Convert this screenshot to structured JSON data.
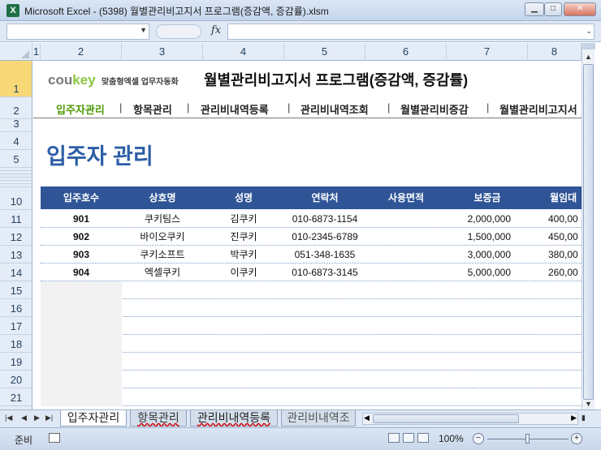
{
  "window": {
    "title": "Microsoft Excel - (5398) 월별관리비고지서 프로그램(증감액, 증감률).xlsm",
    "app_icon": "X"
  },
  "formula_bar": {
    "name_box": "",
    "fx": "fx",
    "formula": ""
  },
  "columns": [
    "1",
    "2",
    "3",
    "4",
    "5",
    "6",
    "7",
    "8"
  ],
  "rows": [
    "1",
    "2",
    "3",
    "4",
    "5",
    "10",
    "11",
    "12",
    "13",
    "14",
    "15",
    "16",
    "17",
    "18",
    "19",
    "20",
    "21"
  ],
  "sheet": {
    "logo": {
      "cou": "cou",
      "key": "key",
      "slogan": "맞춤형엑셀 업무자동화"
    },
    "program_title": "월별관리비고지서 프로그램(증감액, 증감률)",
    "nav": [
      "입주자관리",
      "항목관리",
      "관리비내역등록",
      "관리비내역조회",
      "월별관리비증감",
      "월별관리비고지서"
    ],
    "nav_separator": "|",
    "section_title": "입주자 관리",
    "table": {
      "headers": [
        "입주호수",
        "상호명",
        "성명",
        "연락처",
        "사용면적",
        "보증금",
        "월임대"
      ],
      "rows": [
        [
          "901",
          "쿠키팀스",
          "김쿠키",
          "010-6873-1154",
          "",
          "2,000,000",
          "400,00"
        ],
        [
          "902",
          "바이오쿠키",
          "진쿠키",
          "010-2345-6789",
          "",
          "1,500,000",
          "450,00"
        ],
        [
          "903",
          "쿠키소프트",
          "박쿠키",
          "051-348-1635",
          "",
          "3,000,000",
          "380,00"
        ],
        [
          "904",
          "엑셀쿠키",
          "이쿠키",
          "010-6873-3145",
          "",
          "5,000,000",
          "260,00"
        ]
      ]
    }
  },
  "tabs": [
    "입주자관리",
    "항목관리",
    "관리비내역등록",
    "관리비내역조"
  ],
  "status": {
    "text": "준비",
    "zoom": "100%"
  }
}
